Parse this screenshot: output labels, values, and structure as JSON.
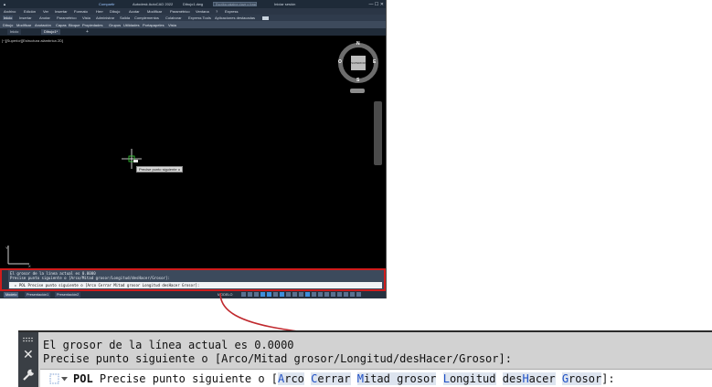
{
  "window": {
    "app_title": "Autodesk AutoCAD 2022",
    "doc_title": "Dibujo1.dwg",
    "share_label": "Compartir",
    "search_placeholder": "Escriba palabra clave o frase",
    "signin_label": "Iniciar sesión"
  },
  "menu": [
    "Archivo",
    "Edición",
    "Ver",
    "Insertar",
    "Formato",
    "Herr",
    "Dibujo",
    "Acotar",
    "Modificar",
    "Paramétrico",
    "Ventana",
    "?",
    "Express"
  ],
  "ribbon_tabs": [
    "Inicio",
    "Insertar",
    "Anotar",
    "Paramétrico",
    "Vista",
    "Administrar",
    "Salida",
    "Complementos",
    "Colaborar",
    "Express Tools",
    "Aplicaciones destacadas"
  ],
  "ribbon_panels": [
    "Dibujo",
    "Modificar",
    "Anotación",
    "Capas",
    "Bloque",
    "Propiedades",
    "Grupos",
    "Utilidades",
    "Portapapeles",
    "Vista"
  ],
  "doc_tabs": [
    "Inicio",
    "Dibujo1*"
  ],
  "viewport": {
    "label": "[−][Superior][Estructura alámbrica 2D]",
    "viewcube": {
      "n": "N",
      "s": "S",
      "e": "E",
      "o": "O",
      "face": "SUPERIOR"
    },
    "wcs_label": "SCU",
    "tooltip": "Precise punto siguiente o",
    "ucs_y": "Y",
    "ucs_x": "X"
  },
  "command_small": {
    "line1": "El grosor de la línea actual es 0.0000",
    "line2": "Precise punto siguiente o [Arco/Mitad grosor/Longitud/desHacer/Grosor]:",
    "input": "▸ POL Precise punto siguiente o [Arco Cerrar Mitad grosor Longitud desHacer Grosor]:"
  },
  "status": {
    "model_label": "MODELO",
    "layout_tabs": [
      "Modelo",
      "Presentación1",
      "Presentación2"
    ]
  },
  "command_big": {
    "line1": "El grosor de la línea actual es 0.0000",
    "line2": "Precise punto siguiente o [Arco/Mitad grosor/Longitud/desHacer/Grosor]:",
    "cmd_name": "POL",
    "prompt_text": "Precise punto siguiente o [",
    "options": [
      {
        "hot": "A",
        "rest": "rco"
      },
      {
        "hot": "C",
        "rest": "errar"
      },
      {
        "hot": "M",
        "rest": "itad grosor"
      },
      {
        "hot": "L",
        "rest": "ongitud"
      },
      {
        "pre": "des",
        "hot": "H",
        "rest": "acer"
      },
      {
        "hot": "G",
        "rest": "rosor"
      }
    ],
    "prompt_end": "]:"
  },
  "icons": [
    "history-icon",
    "close-icon",
    "customize-wrench-icon",
    "recent-commands-icon",
    "callout-arrow"
  ],
  "colors": {
    "callout": "#c0282d",
    "accent": "#1e4fc4",
    "highlight_border": "#d01c1c"
  }
}
